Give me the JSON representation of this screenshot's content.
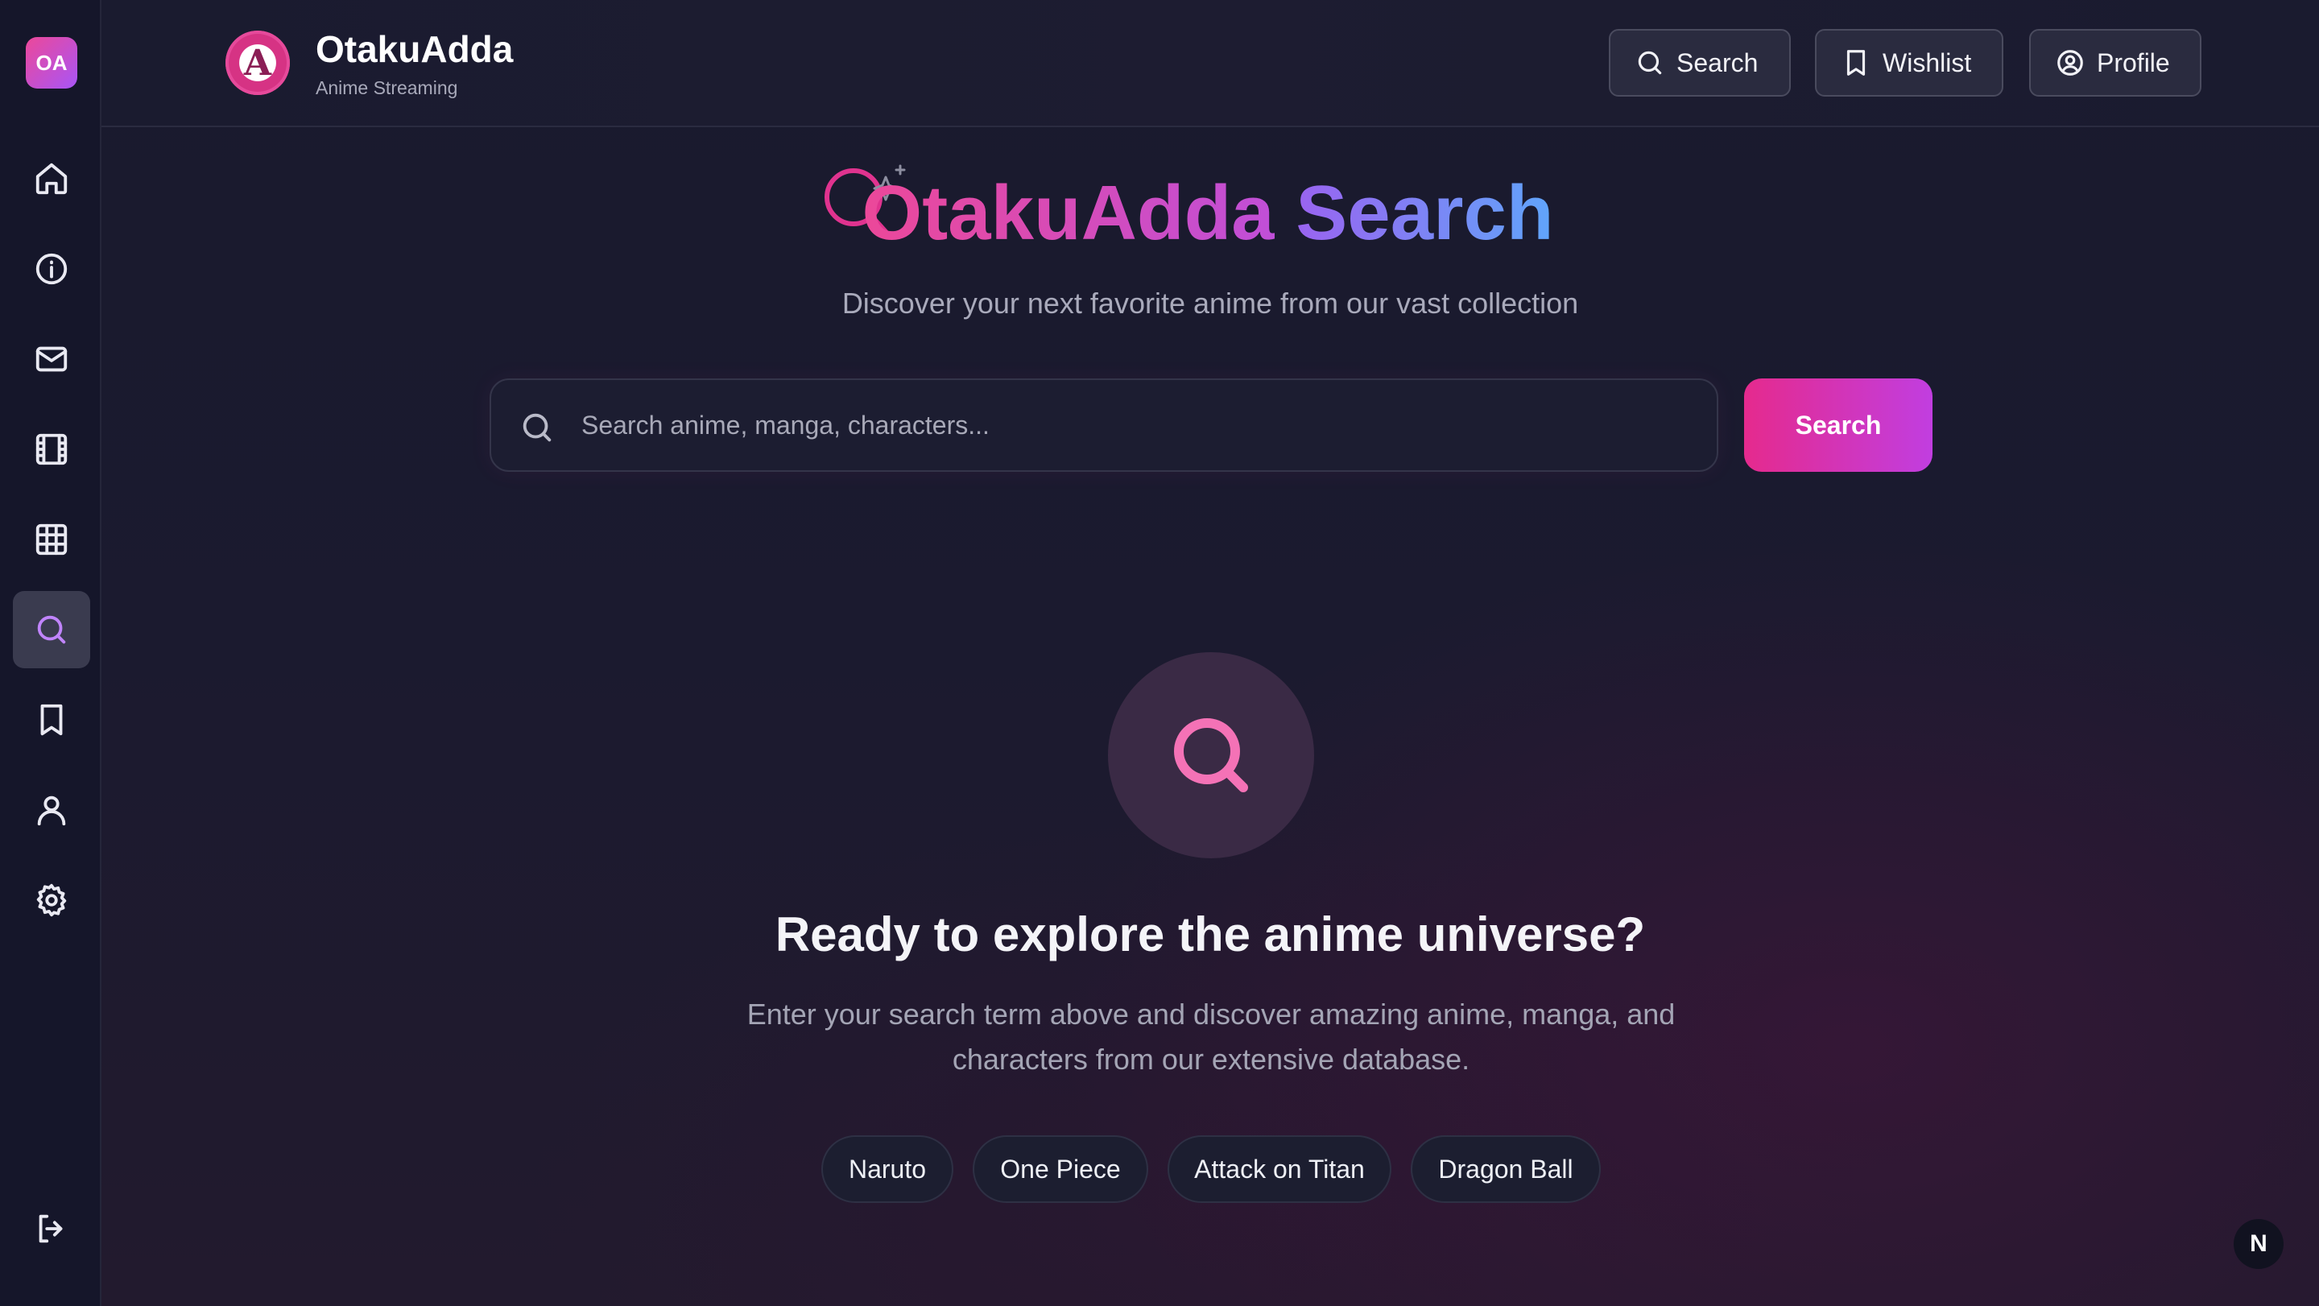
{
  "sidebar": {
    "logo_text": "OA",
    "items": [
      {
        "name": "home",
        "icon": "home-icon"
      },
      {
        "name": "about",
        "icon": "info-icon"
      },
      {
        "name": "contact",
        "icon": "mail-icon"
      },
      {
        "name": "movies",
        "icon": "film-icon"
      },
      {
        "name": "browse",
        "icon": "grid-icon"
      },
      {
        "name": "search",
        "icon": "search-icon",
        "active": true
      },
      {
        "name": "wishlist",
        "icon": "bookmark-icon"
      },
      {
        "name": "profile",
        "icon": "user-icon"
      },
      {
        "name": "settings",
        "icon": "gear-icon"
      }
    ],
    "logout_icon": "logout-icon"
  },
  "header": {
    "logo_text": "A",
    "title": "OtakuAdda",
    "subtitle": "Anime Streaming",
    "buttons": {
      "search": "Search",
      "wishlist": "Wishlist",
      "profile": "Profile"
    }
  },
  "hero": {
    "title_part1": "OtakuAdda",
    "title_part2": "Search",
    "subtitle": "Discover your next favorite anime from our vast collection"
  },
  "search": {
    "placeholder": "Search anime, manga, characters...",
    "value": "",
    "button_label": "Search"
  },
  "empty_state": {
    "title": "Ready to explore the anime universe?",
    "description": "Enter your search term above and discover amazing anime, manga, and characters from our extensive database."
  },
  "suggestions": [
    "Naruto",
    "One Piece",
    "Attack on Titan",
    "Dragon Ball"
  ],
  "corner_badge": "N",
  "colors": {
    "accent_pink": "#ec4899",
    "accent_purple": "#a855f7",
    "accent_blue": "#60a5fa",
    "background": "#191a2e"
  }
}
